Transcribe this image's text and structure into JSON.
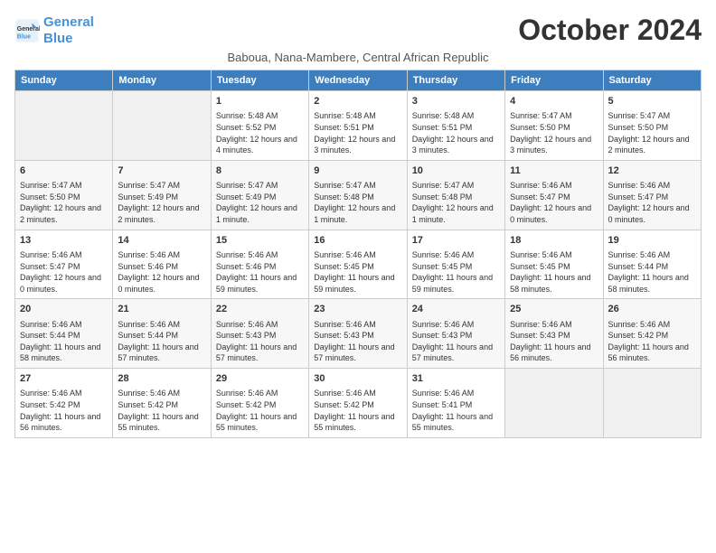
{
  "header": {
    "logo_line1": "General",
    "logo_line2": "Blue",
    "month": "October 2024",
    "location": "Baboua, Nana-Mambere, Central African Republic"
  },
  "days_of_week": [
    "Sunday",
    "Monday",
    "Tuesday",
    "Wednesday",
    "Thursday",
    "Friday",
    "Saturday"
  ],
  "weeks": [
    [
      {
        "day": "",
        "info": ""
      },
      {
        "day": "",
        "info": ""
      },
      {
        "day": "1",
        "info": "Sunrise: 5:48 AM\nSunset: 5:52 PM\nDaylight: 12 hours and 4 minutes."
      },
      {
        "day": "2",
        "info": "Sunrise: 5:48 AM\nSunset: 5:51 PM\nDaylight: 12 hours and 3 minutes."
      },
      {
        "day": "3",
        "info": "Sunrise: 5:48 AM\nSunset: 5:51 PM\nDaylight: 12 hours and 3 minutes."
      },
      {
        "day": "4",
        "info": "Sunrise: 5:47 AM\nSunset: 5:50 PM\nDaylight: 12 hours and 3 minutes."
      },
      {
        "day": "5",
        "info": "Sunrise: 5:47 AM\nSunset: 5:50 PM\nDaylight: 12 hours and 2 minutes."
      }
    ],
    [
      {
        "day": "6",
        "info": "Sunrise: 5:47 AM\nSunset: 5:50 PM\nDaylight: 12 hours and 2 minutes."
      },
      {
        "day": "7",
        "info": "Sunrise: 5:47 AM\nSunset: 5:49 PM\nDaylight: 12 hours and 2 minutes."
      },
      {
        "day": "8",
        "info": "Sunrise: 5:47 AM\nSunset: 5:49 PM\nDaylight: 12 hours and 1 minute."
      },
      {
        "day": "9",
        "info": "Sunrise: 5:47 AM\nSunset: 5:48 PM\nDaylight: 12 hours and 1 minute."
      },
      {
        "day": "10",
        "info": "Sunrise: 5:47 AM\nSunset: 5:48 PM\nDaylight: 12 hours and 1 minute."
      },
      {
        "day": "11",
        "info": "Sunrise: 5:46 AM\nSunset: 5:47 PM\nDaylight: 12 hours and 0 minutes."
      },
      {
        "day": "12",
        "info": "Sunrise: 5:46 AM\nSunset: 5:47 PM\nDaylight: 12 hours and 0 minutes."
      }
    ],
    [
      {
        "day": "13",
        "info": "Sunrise: 5:46 AM\nSunset: 5:47 PM\nDaylight: 12 hours and 0 minutes."
      },
      {
        "day": "14",
        "info": "Sunrise: 5:46 AM\nSunset: 5:46 PM\nDaylight: 12 hours and 0 minutes."
      },
      {
        "day": "15",
        "info": "Sunrise: 5:46 AM\nSunset: 5:46 PM\nDaylight: 11 hours and 59 minutes."
      },
      {
        "day": "16",
        "info": "Sunrise: 5:46 AM\nSunset: 5:45 PM\nDaylight: 11 hours and 59 minutes."
      },
      {
        "day": "17",
        "info": "Sunrise: 5:46 AM\nSunset: 5:45 PM\nDaylight: 11 hours and 59 minutes."
      },
      {
        "day": "18",
        "info": "Sunrise: 5:46 AM\nSunset: 5:45 PM\nDaylight: 11 hours and 58 minutes."
      },
      {
        "day": "19",
        "info": "Sunrise: 5:46 AM\nSunset: 5:44 PM\nDaylight: 11 hours and 58 minutes."
      }
    ],
    [
      {
        "day": "20",
        "info": "Sunrise: 5:46 AM\nSunset: 5:44 PM\nDaylight: 11 hours and 58 minutes."
      },
      {
        "day": "21",
        "info": "Sunrise: 5:46 AM\nSunset: 5:44 PM\nDaylight: 11 hours and 57 minutes."
      },
      {
        "day": "22",
        "info": "Sunrise: 5:46 AM\nSunset: 5:43 PM\nDaylight: 11 hours and 57 minutes."
      },
      {
        "day": "23",
        "info": "Sunrise: 5:46 AM\nSunset: 5:43 PM\nDaylight: 11 hours and 57 minutes."
      },
      {
        "day": "24",
        "info": "Sunrise: 5:46 AM\nSunset: 5:43 PM\nDaylight: 11 hours and 57 minutes."
      },
      {
        "day": "25",
        "info": "Sunrise: 5:46 AM\nSunset: 5:43 PM\nDaylight: 11 hours and 56 minutes."
      },
      {
        "day": "26",
        "info": "Sunrise: 5:46 AM\nSunset: 5:42 PM\nDaylight: 11 hours and 56 minutes."
      }
    ],
    [
      {
        "day": "27",
        "info": "Sunrise: 5:46 AM\nSunset: 5:42 PM\nDaylight: 11 hours and 56 minutes."
      },
      {
        "day": "28",
        "info": "Sunrise: 5:46 AM\nSunset: 5:42 PM\nDaylight: 11 hours and 55 minutes."
      },
      {
        "day": "29",
        "info": "Sunrise: 5:46 AM\nSunset: 5:42 PM\nDaylight: 11 hours and 55 minutes."
      },
      {
        "day": "30",
        "info": "Sunrise: 5:46 AM\nSunset: 5:42 PM\nDaylight: 11 hours and 55 minutes."
      },
      {
        "day": "31",
        "info": "Sunrise: 5:46 AM\nSunset: 5:41 PM\nDaylight: 11 hours and 55 minutes."
      },
      {
        "day": "",
        "info": ""
      },
      {
        "day": "",
        "info": ""
      }
    ]
  ]
}
